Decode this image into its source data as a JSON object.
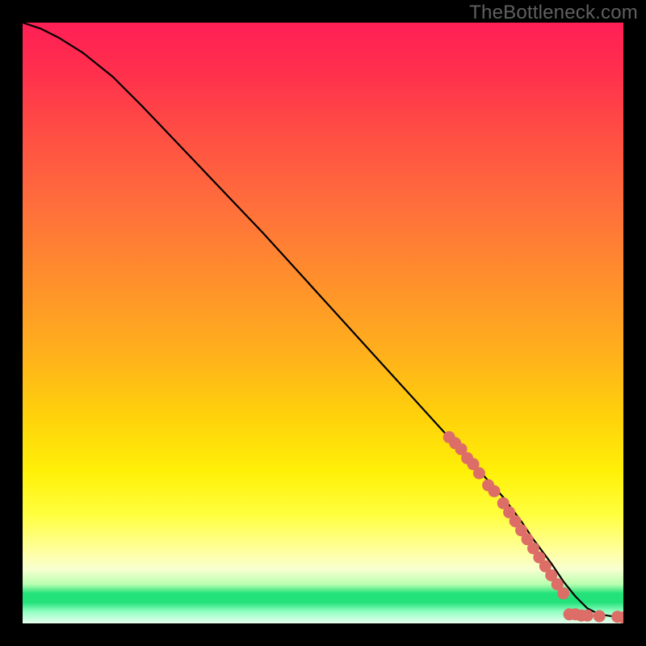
{
  "watermark": "TheBottleneck.com",
  "chart_data": {
    "type": "line",
    "title": "",
    "xlabel": "",
    "ylabel": "",
    "xlim": [
      0,
      100
    ],
    "ylim": [
      0,
      100
    ],
    "grid": false,
    "legend": false,
    "series": [
      {
        "name": "bottleneck-curve",
        "x": [
          0,
          3,
          6,
          10,
          15,
          20,
          30,
          40,
          50,
          60,
          70,
          75,
          80,
          83,
          85,
          88,
          90,
          92,
          94,
          96,
          98,
          100
        ],
        "y": [
          100,
          99,
          97.5,
          95,
          91,
          86,
          75.5,
          65,
          54,
          43,
          32,
          26.5,
          21,
          17,
          14,
          10,
          7,
          4.5,
          2.5,
          1.5,
          1.2,
          1.0
        ]
      }
    ],
    "highlight_points": {
      "name": "knee-markers",
      "points": [
        {
          "x": 71,
          "y": 31
        },
        {
          "x": 72,
          "y": 30
        },
        {
          "x": 73,
          "y": 29
        },
        {
          "x": 74,
          "y": 27.5
        },
        {
          "x": 75,
          "y": 26.5
        },
        {
          "x": 76,
          "y": 25
        },
        {
          "x": 77.5,
          "y": 23
        },
        {
          "x": 78.5,
          "y": 22
        },
        {
          "x": 80,
          "y": 20
        },
        {
          "x": 81,
          "y": 18.5
        },
        {
          "x": 82,
          "y": 17
        },
        {
          "x": 83,
          "y": 15.5
        },
        {
          "x": 84,
          "y": 14
        },
        {
          "x": 85,
          "y": 12.5
        },
        {
          "x": 86,
          "y": 11
        },
        {
          "x": 87,
          "y": 9.5
        },
        {
          "x": 88,
          "y": 8
        },
        {
          "x": 89,
          "y": 6.5
        },
        {
          "x": 90,
          "y": 5
        },
        {
          "x": 91,
          "y": 1.5
        },
        {
          "x": 92,
          "y": 1.5
        },
        {
          "x": 93,
          "y": 1.3
        },
        {
          "x": 94,
          "y": 1.3
        },
        {
          "x": 96,
          "y": 1.2
        },
        {
          "x": 99,
          "y": 1.1
        },
        {
          "x": 100,
          "y": 1.0
        }
      ]
    }
  }
}
